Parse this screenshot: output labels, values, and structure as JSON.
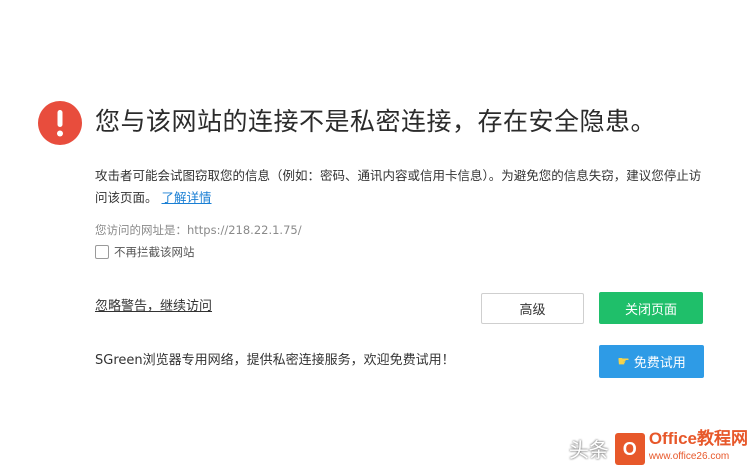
{
  "warning": {
    "headline": "您与该网站的连接不是私密连接，存在安全隐患。",
    "description": "攻击者可能会试图窃取您的信息（例如：密码、通讯内容或信用卡信息）。为避免您的信息失窃，建议您停止访问该页面。",
    "learn_more": "了解详情",
    "url_label": "您访问的网址是：https://218.22.1.75/",
    "checkbox_label": "不再拦截该网站"
  },
  "actions": {
    "ignore_link": "忽略警告，继续访问",
    "advanced_button": "高级",
    "close_button": "关闭页面"
  },
  "promo": {
    "text": "SGreen浏览器专用网络，提供私密连接服务，欢迎免费试用！",
    "trial_button": "免费试用",
    "trial_icon": "pointing-hand-icon"
  },
  "watermark": {
    "prefix": "头条",
    "brand": "Office教程网",
    "site": "www.office26.com"
  },
  "colors": {
    "warning_red": "#e84d3d",
    "close_green": "#1fbf6a",
    "trial_blue": "#2e9be6",
    "link_blue": "#1a7fd4"
  }
}
